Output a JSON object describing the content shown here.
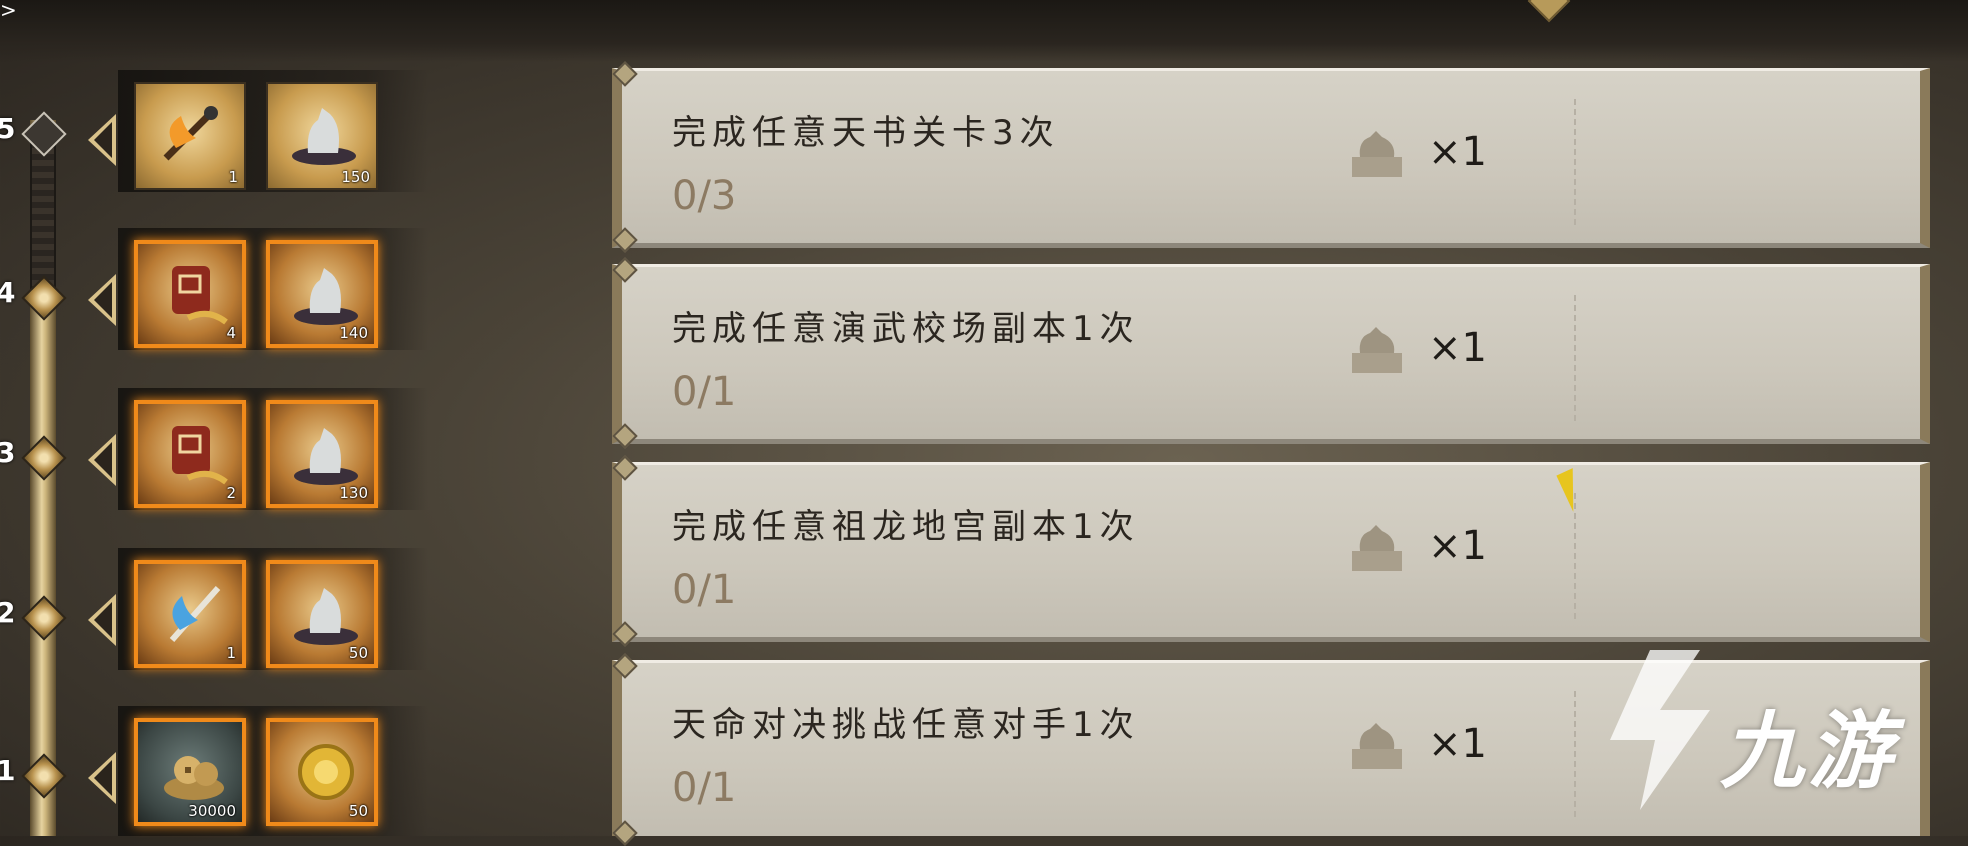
{
  "top_left_glyph": ">",
  "levels": [
    {
      "level": "5",
      "locked": true,
      "rewards": [
        {
          "icon": "fire-axe-icon",
          "count": "1"
        },
        {
          "icon": "qilin-statue-icon",
          "count": "150"
        }
      ]
    },
    {
      "level": "4",
      "locked": false,
      "rewards": [
        {
          "icon": "seed-pouch-icon",
          "count": "4"
        },
        {
          "icon": "qilin-statue-icon",
          "count": "140"
        }
      ]
    },
    {
      "level": "3",
      "locked": false,
      "rewards": [
        {
          "icon": "seed-pouch-icon",
          "count": "2"
        },
        {
          "icon": "qilin-statue-icon",
          "count": "130"
        }
      ]
    },
    {
      "level": "2",
      "locked": false,
      "rewards": [
        {
          "icon": "ice-axe-icon",
          "count": "1"
        },
        {
          "icon": "qilin-statue-icon",
          "count": "50"
        }
      ]
    },
    {
      "level": "1",
      "locked": false,
      "rewards": [
        {
          "icon": "coin-pile-icon",
          "count": "30000"
        },
        {
          "icon": "gold-medal-icon",
          "count": "50"
        }
      ]
    }
  ],
  "tasks": [
    {
      "title": "完成任意天书关卡3次",
      "progress": "0/3",
      "reward": "×1",
      "reward_icon": "qilin-seal-icon"
    },
    {
      "title": "完成任意演武校场副本1次",
      "progress": "0/1",
      "reward": "×1",
      "reward_icon": "qilin-seal-icon"
    },
    {
      "title": "完成任意祖龙地宫副本1次",
      "progress": "0/1",
      "reward": "×1",
      "reward_icon": "qilin-seal-icon"
    },
    {
      "title": "天命对决挑战任意对手1次",
      "progress": "0/1",
      "reward": "×1",
      "reward_icon": "qilin-seal-icon"
    }
  ],
  "watermark": {
    "text": "九游",
    "icon": "jiuyou-logo-icon"
  },
  "colors": {
    "highlight": "#f08a1a",
    "card": "#d6d2c7",
    "cursor": "#e7c51e"
  }
}
